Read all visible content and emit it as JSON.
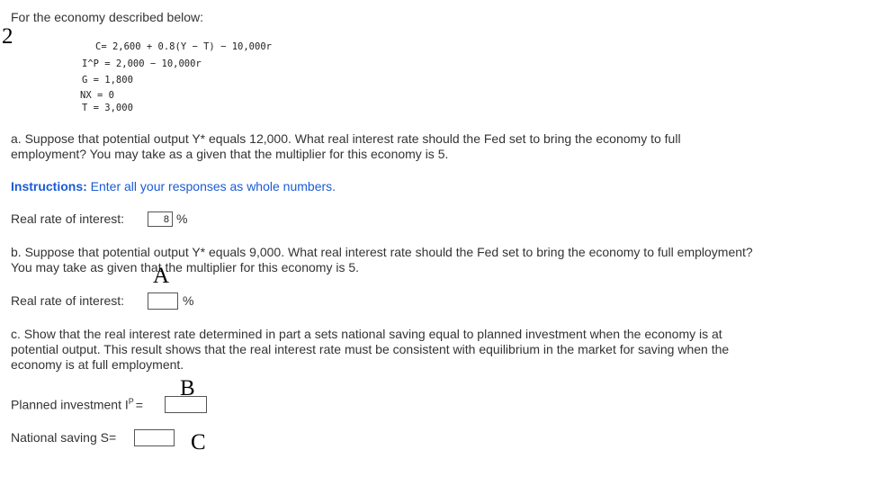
{
  "intro": "For the economy described below:",
  "question_number": "2",
  "equations": {
    "c": "C= 2,600 + 0.8(Y − T) − 10,000r",
    "ip": "I^P = 2,000 − 10,000r",
    "g": "G = 1,800",
    "nx": "NX = 0",
    "t": "T = 3,000"
  },
  "part_a": {
    "line1": "a. Suppose that potential output Y* equals 12,000. What real interest rate should the Fed set to bring the economy to full",
    "line2": "employment? You may take as a given that the multiplier for this economy is 5."
  },
  "instructions": {
    "label": "Instructions:",
    "text": " Enter all your responses as whole numbers."
  },
  "answer_a": {
    "label": "Real rate of interest:",
    "value": "8",
    "unit": "%"
  },
  "part_b": {
    "line1": "b. Suppose that potential output Y* equals 9,000. What real interest rate should the Fed set to bring the economy to full employment?",
    "line2": "You may take as given that the multiplier for this economy is 5."
  },
  "answer_b": {
    "label": "Real rate of interest:",
    "value": "",
    "unit": "%"
  },
  "part_c": {
    "line1": "c. Show that the real interest rate determined in part a sets national saving equal to planned investment when the economy is at",
    "line2": "potential output. This result shows that the real interest rate must be consistent with equilibrium in the market for saving when the",
    "line3": "economy is at full employment."
  },
  "planned_investment": {
    "label": "Planned investment I",
    "sup": "P",
    "eq": "=",
    "value": ""
  },
  "national_saving": {
    "label": "National saving S",
    "eq": "=",
    "value": ""
  },
  "handwritten": {
    "a": "A",
    "b": "B",
    "c": "C"
  }
}
